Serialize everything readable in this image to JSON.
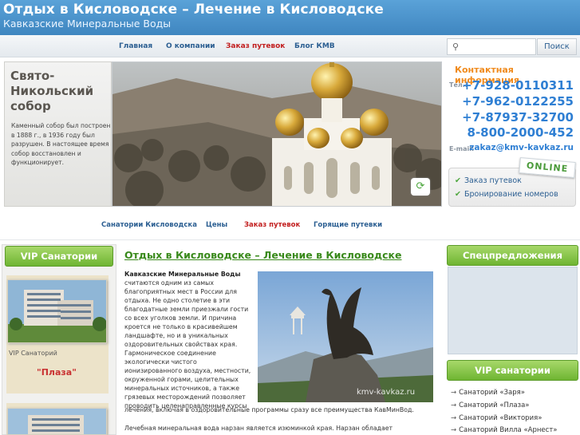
{
  "header": {
    "title": "Отдых в Кисловодске – Лечение в Кисловодске",
    "subtitle": "Кавказские Минеральные Воды"
  },
  "topnav": {
    "items": [
      "Главная",
      "О компании",
      "Заказ путевок",
      "Блог КМВ"
    ],
    "active_index": 2
  },
  "search": {
    "placeholder": "",
    "button_label": "Поиск",
    "icon": "search-icon"
  },
  "hero": {
    "title": "Свято-Никольский собор",
    "text": "Каменный собор был построен в 1888 г., в 1936 году был разрушен. В настоящее время собор восстановлен и функционирует."
  },
  "contacts": {
    "title": "Контактная информация",
    "tel_label": "Тел.:",
    "phones": [
      "+7-928-0110311",
      "+7-962-0122255",
      "+7-87937-32700",
      "8-800-2000-452"
    ],
    "email_label": "E-mail:",
    "email": "zakaz@kmv-kavkaz.ru"
  },
  "online": {
    "badge": "ONLINE",
    "links": [
      "Заказ путевок",
      "Бронирование номеров"
    ]
  },
  "subnav": {
    "items": [
      "Санатории Кисловодска",
      "Цены",
      "Заказ путевок",
      "Горящие путевки"
    ],
    "active_index": 2
  },
  "left": {
    "heading": "VIP Санатории",
    "card1_caption": "VIP Санаторий",
    "card1_name": "\"Плаза\""
  },
  "main": {
    "title": "Отдых в Кисловодске – Лечение в Кисловодске",
    "lead_bold": "Кавказские Минеральные Воды",
    "lead_text": "считаются одним из самых благоприятных мест в России для отдыха. Не одно столетие в эти благодатные земли приезжали гости со всех уголков земли. И причина кроется не только в красивейшем ландшафте, но и в уникальных оздоровительных свойствах края. Гармоническое соединение экологически чистого ионизированного воздуха, местности, окруженной горами, целительных минеральных источников, а также грязевых месторождений позволяет проводить целенаправленные курсы",
    "line2": "лечения, включая в оздоровительные программы сразу все преимущества КавМинВод.",
    "line3": "Лечебная минеральная вода нарзан является изюминкой края. Нарзан обладает",
    "watermark": "kmv-kavkaz.ru"
  },
  "right": {
    "heading1": "Спецпредложения",
    "heading2": "VIP санатории",
    "links": [
      "Санаторий «Заря»",
      "Санаторий «Плаза»",
      "Санаторий «Виктория»",
      "Санаторий Вилла «Арнест»"
    ]
  }
}
